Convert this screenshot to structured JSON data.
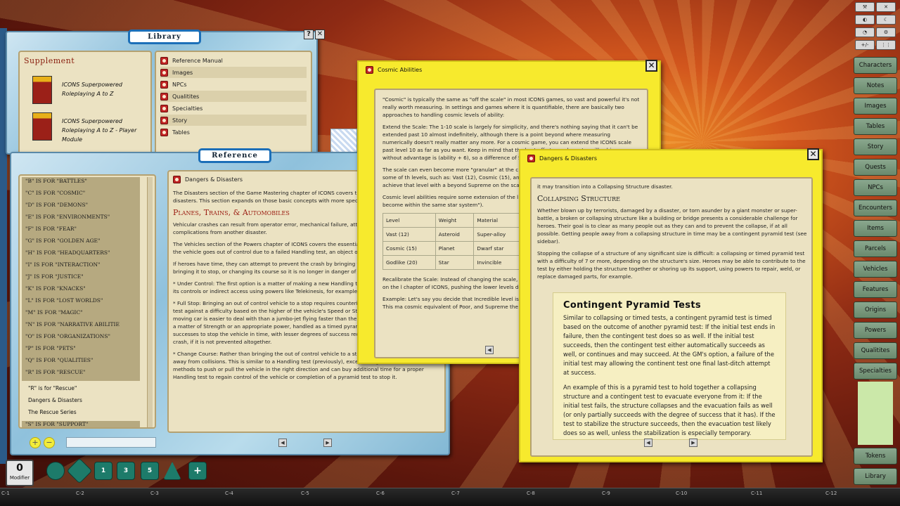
{
  "library": {
    "title": "Library",
    "help": "?",
    "close": "✕",
    "supplement_title": "Supplement",
    "books": [
      {
        "line1": "ICONS Superpowered",
        "line2": "Roleplaying A to Z"
      },
      {
        "line1": "ICONS Superpowered",
        "line2": "Roleplaying A to Z - Player",
        "line3": "Module"
      }
    ],
    "items": [
      "Reference Manual",
      "Images",
      "NPCs",
      "Qualitites",
      "Specialties",
      "Story",
      "Tables"
    ]
  },
  "reference": {
    "title": "Reference",
    "list": [
      "\"B\" IS FOR \"BATTLES\"",
      "\"C\" IS FOR \"COSMIC\"",
      "\"D\" IS FOR \"DEMONS\"",
      "\"E\" IS FOR \"ENVIRONMENTS\"",
      "\"F\" IS FOR \"FEAR\"",
      "\"G\" IS FOR \"GOLDEN AGE\"",
      "\"H\" IS FOR \"HEADQUARTERS\"",
      "\"I\" IS FOR \"INTERACTION\"",
      "\"J\" IS FOR \"JUSTICE\"",
      "\"K\" IS FOR \"KNACKS\"",
      "\"L\" IS FOR \"LOST WORLDS\"",
      "\"M\" IS FOR \"MAGIC\"",
      "\"N\" IS FOR \"NARRATIVE ABILITIE",
      "\"O\" IS FOR \"ORGANIZATIONS\"",
      "\"P\" IS FOR \"PETS\"",
      "\"Q\" IS FOR \"QUALITIES\"",
      "\"R\" IS FOR \"RESCUE\""
    ],
    "sub": [
      "\"R\" is for \"Rescue\"",
      "Dangers & Disasters",
      "The Rescue Series"
    ],
    "last": "\"S\" IS FOR \"SUPPORT\"",
    "doc_title": "Dangers & Disasters",
    "intro": "The Disasters section of the Game Mastering chapter of ICONS covers the various dangers and disasters. This section expands on those basic concepts with more specific examples.",
    "heading": "Planes, Trains, & Automobiles",
    "paras": [
      "Vehicular crashes can result from operator error, mechanical failure, attacks, bad weather or complications from another disaster.",
      "The Vehicles section of the Powers chapter of ICONS covers the essentials of what happens in a crash: the vehicle goes out of control due to a failed Handling test, an object or obstacle.",
      "If heroes have time, they can attempt to prevent the crash by bringing the vehicle under control, bringing it to stop, or changing its course so it is no longer in danger of a collision with an obstacle:",
      "* Under Control: The first option is a matter of making a new Handling test, either with direct access to its controls or indirect access using powers like Telekinesis, for examples.",
      "* Full Stop: Bringing an out of control vehicle to a stop requires countering its momentum, meaning a test against a difficulty based on the higher of the vehicle's Speed or Strength; naturally a slowly-moving car is easier to deal with than a jumbo-jet flying faster than the speed of sound! This might be a matter of Strength or an appropriate power, handled as a timed pyramid test, requiring sufficient successes to stop the vehicle in time, with lesser degrees of success reducing the effective level of the crash, if it is not prevented altogether.",
      "* Change Course: Rather than bringing the out of control vehicle to a stop, the heroes might redirect it away from collisions. This is similar to a Handling test (previously), except using more brute force methods to push or pull the vehicle in the right direction and can buy additional time for a proper Handling test to regain control of the vehicle or completion of a pyramid test to stop it."
    ]
  },
  "cosmic": {
    "title": "Cosmic Abilities",
    "p1": "\"Cosmic\" is typically the same as \"off the scale\" in most ICONS games, so vast and powerful it's not really worth measuring. In settings and games where it is quantifiable, there are basically two approaches to handling cosmic levels of ability:",
    "p2": "Extend the Scale: The 1-10 scale is largely for simplicity, and there's nothing saying that it can't be extended past 10 almost indefinitely, although there is a point beyond where measuring numerically doesn't really matter any more. For a cosmic game, you can extend the ICONS scale past level 10 as far as you want. Keep in mind that the best effort any character will achieve without advantage is (ability + 6), so a difference of S",
    "p3": "The scale can even become more \"granular\" at the c intermediate value, but leapfrogging over some of th levels, such as: Vast (12), Cosmic (15), and Godlike (20 Supreme character will only achieve that level with a beyond Supreme on the scale as Supreme is beyond",
    "p4": "Cosmic level abilities require some extension of the l The \"virtually anywhere\" distance of level 10 become within the same star system\").",
    "table": [
      [
        "Level",
        "Weight",
        "Material"
      ],
      [
        "Vast (12)",
        "Asteroid",
        "Super-alloy"
      ],
      [
        "Cosmic (15)",
        "Planet",
        "Dwarf star"
      ],
      [
        "Godlike (20)",
        "Star",
        "Invincible"
      ]
    ],
    "p5": "Recalibrate the Scale: Instead of changing the scale, means. In essence, you shift the descriptions on the l chapter of ICONS, pushing the lower levels down \"of levels above.",
    "p6": "Example: Let's say you decide that Incredible level is scale, shifting everything down by four levels. This ma cosmic equivalent of Poor, and Supreme the cosmic"
  },
  "dangers": {
    "title": "Dangers & Disasters",
    "p0": "it may transition into a Collapsing Structure disaster.",
    "heading": "Collapsing Structure",
    "p1": "Whether blown up by terrorists, damaged by a disaster, or torn asunder by a giant monster or super-battle, a broken or collapsing structure like a building or bridge presents a considerable challenge for heroes. Their goal is to clear as many people out as they can and to prevent the collapse, if at all possible. Getting people away from a collapsing structure in time may be a contingent pyramid test (see sidebar).",
    "p2": "Stopping the collapse of a structure of any significant size is difficult: a collapsing or timed pyramid test with a difficulty of 7 or more, depending on the structure's size. Heroes may be able to contribute to the test by either holding the structure together or shoring up its support, using powers to repair, weld, or replace damaged parts, for example.",
    "sidebar_title": "Contingent Pyramid Tests",
    "sb1": "Similar to collapsing or timed tests, a contingent pyramid test is timed based on the outcome of another pyramid test: If the initial test ends in failure, then the contingent test does so as well. If the initial test succeeds, then the contingent test either automatically succeeds as well, or continues and may succeed. At the GM's option, a failure of the initial test may allowing the continent test one final last-ditch attempt at success.",
    "sb2": "An example of this is a pyramid test to hold together a collapsing structure and a contingent test to evacuate everyone from it: If the initial test fails, the structure collapses and the evacuation fails as well (or only partially succeeds with the degree of success that it has). If the test to stabilize the structure succeeds, then the evacuation test likely does so as well, unless the stabilization is especially temporary."
  },
  "sidebar_buttons": [
    "Characters",
    "Notes",
    "Images",
    "Tables",
    "Story",
    "Quests",
    "NPCs",
    "Encounters",
    "Items",
    "Parcels",
    "Vehicles",
    "Features",
    "Origins",
    "Powers",
    "Qualitites",
    "Specialties"
  ],
  "bottom_buttons": [
    "Tokens",
    "Library"
  ],
  "tools": [
    "⚒",
    "✕",
    "◐",
    "☾",
    "◔",
    "⚙",
    "+/-",
    "⋮⋮"
  ],
  "modifier": {
    "value": "0",
    "label": "Modifier"
  },
  "dice": [
    "",
    "",
    "1",
    "3",
    "5",
    "",
    "+"
  ],
  "cells": [
    "C-1",
    "C-2",
    "C-3",
    "C-4",
    "C-5",
    "C-6",
    "C-7",
    "C-8",
    "C-9",
    "C-10",
    "C-11",
    "C-12"
  ],
  "nav": {
    "prev": "◀",
    "next": "▶"
  }
}
